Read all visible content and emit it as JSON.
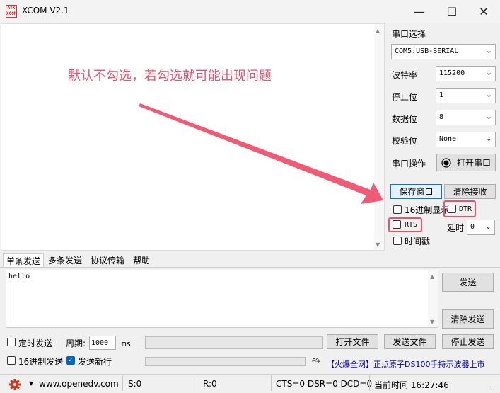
{
  "window": {
    "title": "XCOM V2.1",
    "logo_text": [
      "ATK",
      "XCOM"
    ]
  },
  "window_controls": {
    "minimize": "—",
    "maximize": "☐",
    "close": "✕"
  },
  "receive": {
    "annotation": "默认不勾选，若勾选就可能出现问题"
  },
  "panel": {
    "port_select_label": "串口选择",
    "port_value": "COM5:USB-SERIAL",
    "baud_label": "波特率",
    "baud_value": "115200",
    "stop_label": "停止位",
    "stop_value": "1",
    "data_label": "数据位",
    "data_value": "8",
    "parity_label": "校验位",
    "parity_value": "None",
    "port_op_label": "串口操作",
    "open_port_label": "打开串口",
    "save_window_label": "保存窗口",
    "clear_recv_label": "清除接收",
    "hex_display_label": "16进制显示",
    "dtr_label": "DTR",
    "rts_label": "RTS",
    "delay_label": "延时",
    "delay_value": "0",
    "timestamp_label": "时间戳"
  },
  "tabs": [
    "单条发送",
    "多条发送",
    "协议传输",
    "帮助"
  ],
  "send": {
    "text": "hello",
    "send_label": "发送",
    "clear_send_label": "清除发送",
    "timed_send_label": "定时发送",
    "period_label": "周期:",
    "period_value": "1000",
    "period_unit": "ms",
    "hex_send_label": "16进制发送",
    "newline_label": "发送新行",
    "newline_checked": true,
    "open_file_label": "打开文件",
    "send_file_label": "发送文件",
    "stop_send_label": "停止发送",
    "progress_percent": "0%",
    "progress_value": 0,
    "promo_text": "【火爆全网】正点原子DS100手持示波器上市"
  },
  "status": {
    "url": "www.openedv.com",
    "sent": "S:0",
    "received": "R:0",
    "lines": "CTS=0 DSR=0 DCD=0",
    "time": "当前时间 16:27:46"
  },
  "colors": {
    "annotation": "#e8546c",
    "accent": "#0078d7",
    "link": "#0000cc"
  }
}
